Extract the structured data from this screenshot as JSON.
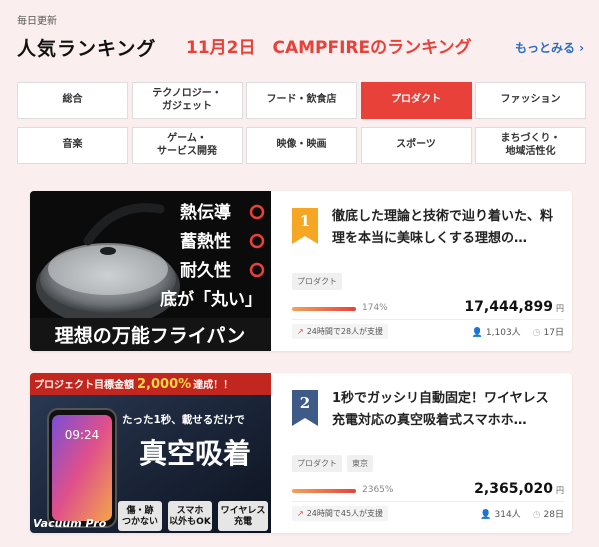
{
  "header": {
    "daily_update": "毎日更新",
    "title": "人気ランキング",
    "headline": "11月2日　CAMPFIREのランキング",
    "more_link": "もっとみる ›"
  },
  "categories": [
    {
      "label": "総合",
      "active": false
    },
    {
      "label": "テクノロジー・\nガジェット",
      "active": false
    },
    {
      "label": "フード・飲食店",
      "active": false
    },
    {
      "label": "プロダクト",
      "active": true
    },
    {
      "label": "ファッション",
      "active": false
    },
    {
      "label": "音楽",
      "active": false
    },
    {
      "label": "ゲーム・\nサービス開発",
      "active": false
    },
    {
      "label": "映像・映画",
      "active": false
    },
    {
      "label": "スポーツ",
      "active": false
    },
    {
      "label": "まちづくり・\n地域活性化",
      "active": false
    }
  ],
  "projects": [
    {
      "rank": "1",
      "rank_color": "#f5a623",
      "title": "徹底した理論と技術で辿り着いた、料理を本当に美味しくする理想の…",
      "tags": [
        "プロダクト"
      ],
      "progress_pct": "174%",
      "progress_fraction": 1.0,
      "amount": "17,444,899",
      "currency": "円",
      "support_24h": "24時間で28人が支援",
      "backers": "1,103人",
      "days_left": "17日",
      "image_text": {
        "line1": "熱伝導",
        "line2": "蓄熱性",
        "line3": "耐久性",
        "line4": "底が「丸い」",
        "banner": "理想の万能フライパン"
      }
    },
    {
      "rank": "2",
      "rank_color": "#3e5a86",
      "title": "1秒でガッシリ自動固定！ワイヤレス充電対応の真空吸着式スマホホ…",
      "tags": [
        "プロダクト",
        "東京"
      ],
      "progress_pct": "2365%",
      "progress_fraction": 1.0,
      "amount": "2,365,020",
      "currency": "円",
      "support_24h": "24時間で45人が支援",
      "backers": "314人",
      "days_left": "28日",
      "image_text": {
        "goal_banner_pre": "プロジェクト目標金額",
        "goal_amount": "2,000%",
        "goal_banner_post": "達成！！",
        "phone_time": "09:24",
        "catch": "たった1秒、載せるだけで",
        "big": "真空吸着",
        "brand": "Vacuum Pro",
        "badge1": "傷・跡\nつかない",
        "badge2": "スマホ\n以外もOK",
        "badge3": "ワイヤレス\n充電"
      }
    }
  ]
}
